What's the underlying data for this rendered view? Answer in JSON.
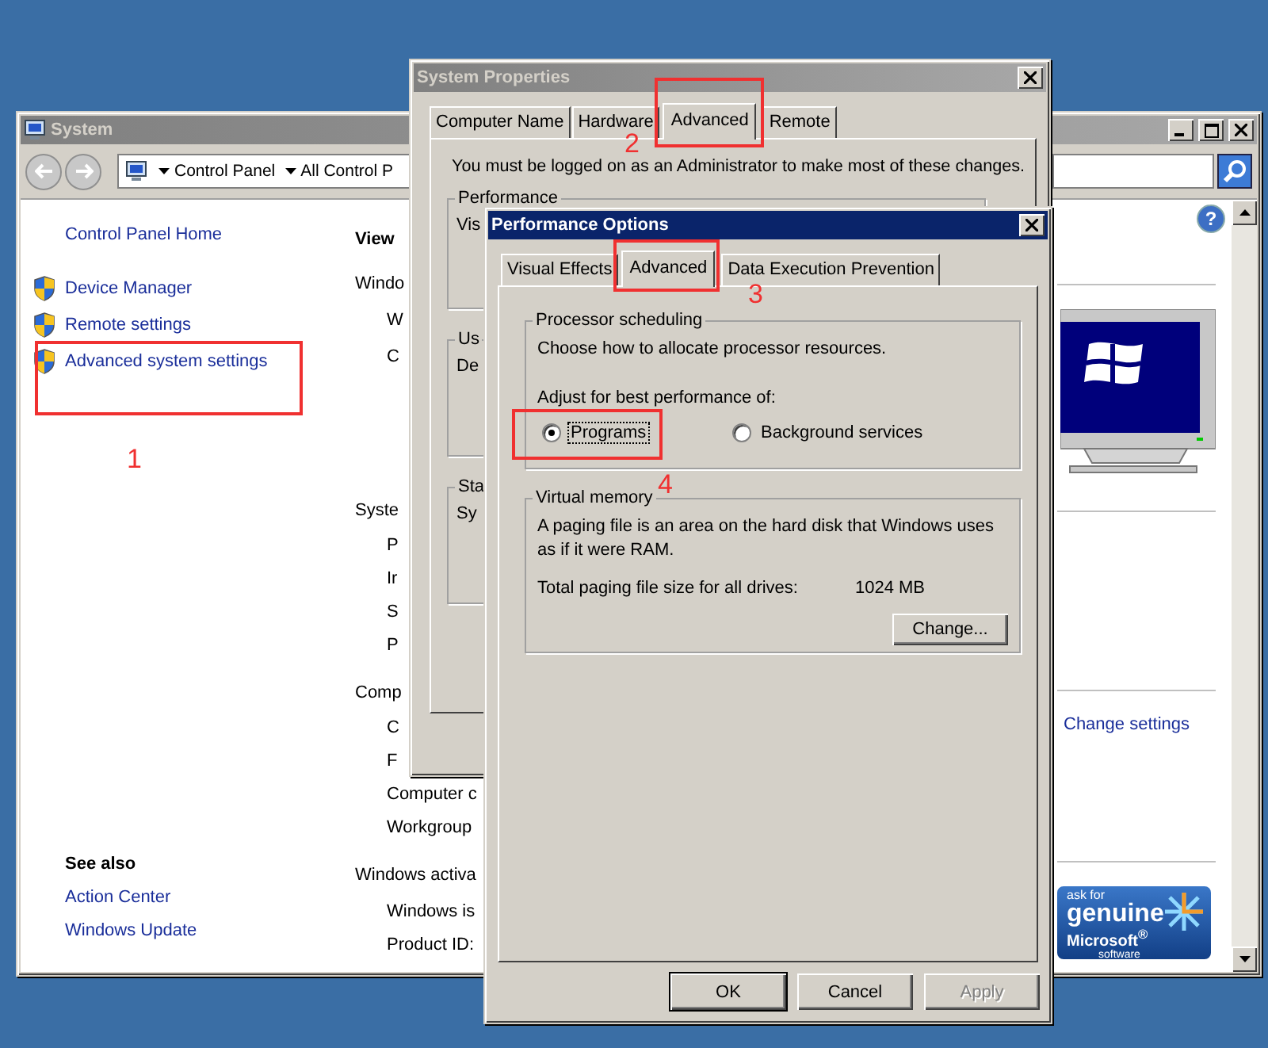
{
  "system_window": {
    "title": "System",
    "active": false,
    "address": [
      "Control Panel",
      "All Control P"
    ],
    "nav_links": [
      {
        "kind": "plain",
        "label": "Control Panel Home"
      },
      {
        "kind": "shield",
        "label": "Device Manager"
      },
      {
        "kind": "shield",
        "label": "Remote settings"
      },
      {
        "kind": "shield",
        "label": "Advanced system settings"
      }
    ],
    "see_also": {
      "heading": "See also",
      "links": [
        "Action Center",
        "Windows Update"
      ]
    },
    "main_column": [
      {
        "kind": "heading",
        "text": "View"
      },
      {
        "kind": "section",
        "text": "Windo"
      },
      {
        "kind": "item",
        "text": "W"
      },
      {
        "kind": "item",
        "text": "C"
      },
      {
        "kind": "section",
        "text": "Syste"
      },
      {
        "kind": "item",
        "text": "P"
      },
      {
        "kind": "item",
        "text": "Ir"
      },
      {
        "kind": "item",
        "text": "S"
      },
      {
        "kind": "item",
        "text": "P"
      },
      {
        "kind": "section",
        "text": "Comp"
      },
      {
        "kind": "item",
        "text": "C"
      },
      {
        "kind": "item",
        "text": "F"
      },
      {
        "kind": "item",
        "text": "Computer c"
      },
      {
        "kind": "item",
        "text": "Workgroup"
      },
      {
        "kind": "section",
        "text": "Windows activa"
      },
      {
        "kind": "item",
        "text": "Windows is"
      },
      {
        "kind": "item",
        "text": "Product ID:"
      }
    ],
    "help_icon": "?",
    "change_settings": "Change settings",
    "genuine_badge": [
      "ask for",
      "genuine",
      "Microsoft$^{®}$",
      "software"
    ]
  },
  "system_properties": {
    "title": "System Properties",
    "active": false,
    "tabs": [
      {
        "label": "Computer Name",
        "selected": false
      },
      {
        "label": "Hardware",
        "selected": false
      },
      {
        "label": "Advanced",
        "selected": true
      },
      {
        "label": "Remote",
        "selected": false
      }
    ],
    "notice": "You must be logged on as an Administrator to make most of these changes.",
    "groups": [
      {
        "label": "Performance",
        "text": "Vis"
      },
      {
        "label": "Us",
        "text": "De"
      },
      {
        "label": "Sta",
        "text": "Sy"
      }
    ]
  },
  "performance_options": {
    "title": "Performance Options",
    "active": true,
    "tabs": [
      {
        "label": "Visual Effects",
        "selected": false
      },
      {
        "label": "Advanced",
        "selected": true
      },
      {
        "label": "Data Execution Prevention",
        "selected": false
      }
    ],
    "processor_scheduling": {
      "label": "Processor scheduling",
      "description": "Choose how to allocate processor resources.",
      "prompt": "Adjust for best performance of:",
      "options": [
        {
          "label": "Programs",
          "selected": true
        },
        {
          "label": "Background services",
          "selected": false
        }
      ]
    },
    "virtual_memory": {
      "label": "Virtual memory",
      "description": "A paging file is an area on the hard disk that Windows uses as if it were RAM.",
      "total_label": "Total paging file size for all drives:",
      "total_value": "1024 MB",
      "button": "Change..."
    },
    "buttons": [
      {
        "label": "OK",
        "disabled": false
      },
      {
        "label": "Cancel",
        "disabled": false
      },
      {
        "label": "Apply",
        "disabled": true
      }
    ]
  },
  "annotations": [
    {
      "label": "1"
    },
    {
      "label": "2"
    },
    {
      "label": "3"
    },
    {
      "label": "4"
    }
  ]
}
